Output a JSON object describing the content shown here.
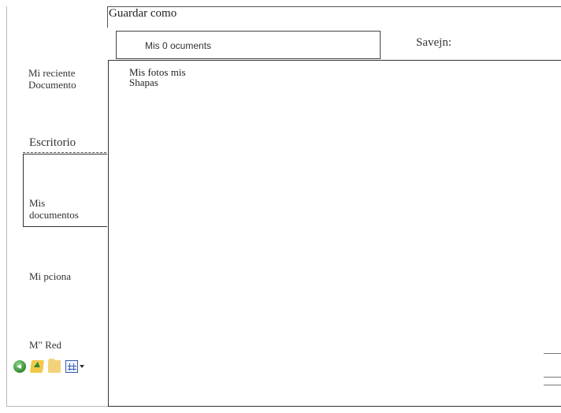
{
  "dialog": {
    "title": "Guardar como"
  },
  "save_in": {
    "label": "Savejn:",
    "value": "Mis 0 ocuments"
  },
  "places": {
    "recent": [
      "Mi reciente",
      "Documento"
    ],
    "desktop": "Escritorio",
    "documents": [
      "Mis",
      "documentos"
    ],
    "computer": "Mi pciona",
    "network": "M\" Red"
  },
  "files": [
    {
      "name": "Mis fotos mis"
    },
    {
      "name": "Shapas"
    }
  ],
  "toolbar": {
    "icons": [
      "back-icon",
      "up-folder-icon",
      "new-folder-icon",
      "views-menu-icon"
    ]
  }
}
